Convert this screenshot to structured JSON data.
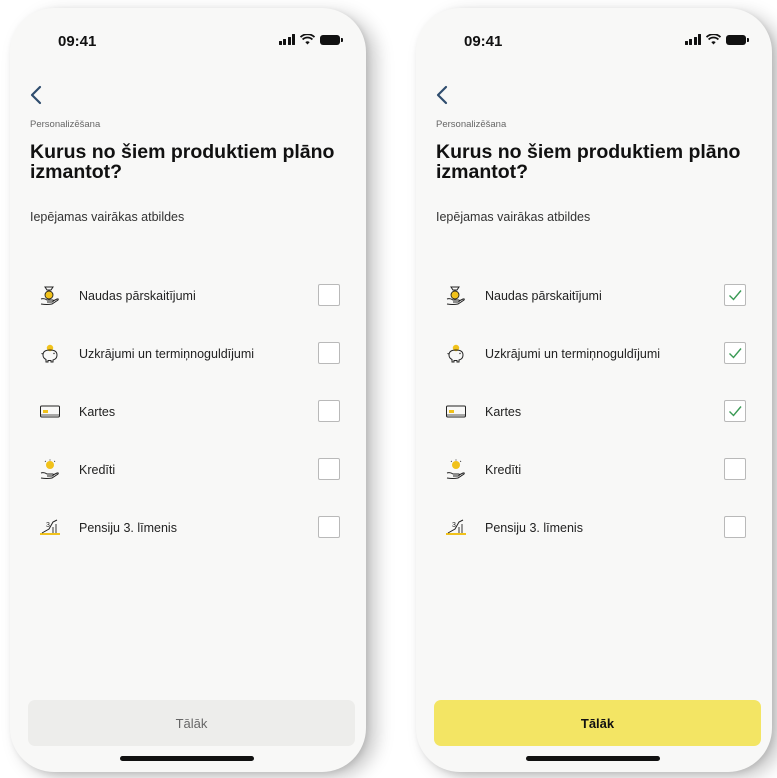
{
  "screens": [
    {
      "status": {
        "time": "09:41"
      },
      "breadcrumb": "Personalizēšana",
      "title": "Kurus no šiem produktiem plāno izmantot?",
      "hint": "Iepējamas vairākas atbildes",
      "options": [
        {
          "label": "Naudas pārskaitījumi",
          "icon": "money-transfer-icon",
          "checked": false
        },
        {
          "label": "Uzkrājumi un termiņnoguldījumi",
          "icon": "piggy-bank-icon",
          "checked": false
        },
        {
          "label": "Kartes",
          "icon": "card-icon",
          "checked": false
        },
        {
          "label": "Kredīti",
          "icon": "loan-icon",
          "checked": false
        },
        {
          "label": "Pensiju 3. līmenis",
          "icon": "pension-chart-icon",
          "checked": false
        }
      ],
      "button": {
        "label": "Tālāk",
        "state": "disabled"
      }
    },
    {
      "status": {
        "time": "09:41"
      },
      "breadcrumb": "Personalizēšana",
      "title": "Kurus no šiem produktiem plāno izmantot?",
      "hint": "Iepējamas vairākas atbildes",
      "options": [
        {
          "label": "Naudas pārskaitījumi",
          "icon": "money-transfer-icon",
          "checked": true
        },
        {
          "label": "Uzkrājumi un termiņnoguldījumi",
          "icon": "piggy-bank-icon",
          "checked": true
        },
        {
          "label": "Kartes",
          "icon": "card-icon",
          "checked": true
        },
        {
          "label": "Kredīti",
          "icon": "loan-icon",
          "checked": false
        },
        {
          "label": "Pensiju 3. līmenis",
          "icon": "pension-chart-icon",
          "checked": false
        }
      ],
      "button": {
        "label": "Tālāk",
        "state": "enabled"
      }
    }
  ],
  "colors": {
    "accent_yellow": "#f3e564",
    "icon_yellow": "#f1c21b",
    "check_green": "#3a9a55",
    "back_arrow": "#2f4d6e",
    "disabled_button": "#ededeb"
  }
}
